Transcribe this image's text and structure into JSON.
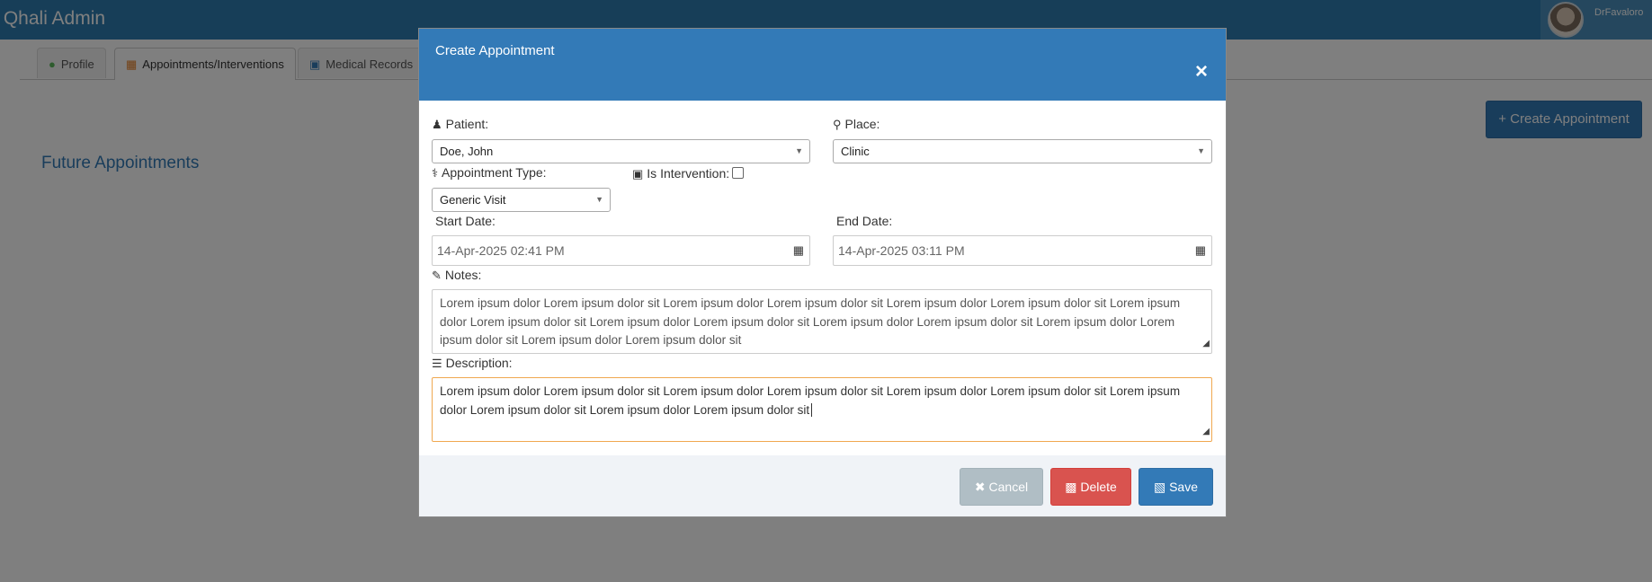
{
  "app": {
    "title": "' Qhali Admin",
    "username": "DrFavaloro"
  },
  "tabs": [
    {
      "label": "Profile",
      "icon": "user-icon"
    },
    {
      "label": "Appointments/Interventions",
      "icon": "calendar-icon"
    },
    {
      "label": "Medical Records",
      "icon": "medkit-icon"
    }
  ],
  "page": {
    "create_button": "Create Appointment",
    "future_title": "Future Appointments"
  },
  "modal": {
    "title": "Create Appointment",
    "close": "×",
    "patient_label": "Patient:",
    "patient_value": "Doe, John",
    "place_label": "Place:",
    "place_value": "Clinic",
    "type_label": "Appointment Type:",
    "type_value": "Generic Visit",
    "intervention_label": "Is Intervention:",
    "intervention_checked": false,
    "start_label": "Start Date:",
    "start_value": "14-Apr-2025  02:41  PM",
    "end_label": "End Date:",
    "end_value": "14-Apr-2025  03:11  PM",
    "notes_label": "Notes:",
    "notes_value": "Lorem ipsum dolor Lorem ipsum dolor sit Lorem ipsum dolor Lorem ipsum dolor sit Lorem ipsum dolor Lorem ipsum dolor sit Lorem ipsum dolor Lorem ipsum dolor sit Lorem ipsum dolor Lorem ipsum dolor sit Lorem ipsum dolor Lorem ipsum dolor sit Lorem ipsum dolor Lorem ipsum dolor sit Lorem ipsum dolor Lorem ipsum dolor sit",
    "description_label": "Description:",
    "description_value": "Lorem ipsum dolor Lorem ipsum dolor sit Lorem ipsum dolor Lorem ipsum dolor sit Lorem ipsum dolor Lorem ipsum dolor sit Lorem ipsum dolor Lorem ipsum dolor sit Lorem ipsum dolor Lorem ipsum dolor sit",
    "cancel_label": "Cancel",
    "delete_label": "Delete",
    "save_label": "Save"
  },
  "colors": {
    "primary": "#337ab7",
    "danger": "#d9534f",
    "muted": "#b0bec5",
    "navbar": "#2e7db0"
  }
}
